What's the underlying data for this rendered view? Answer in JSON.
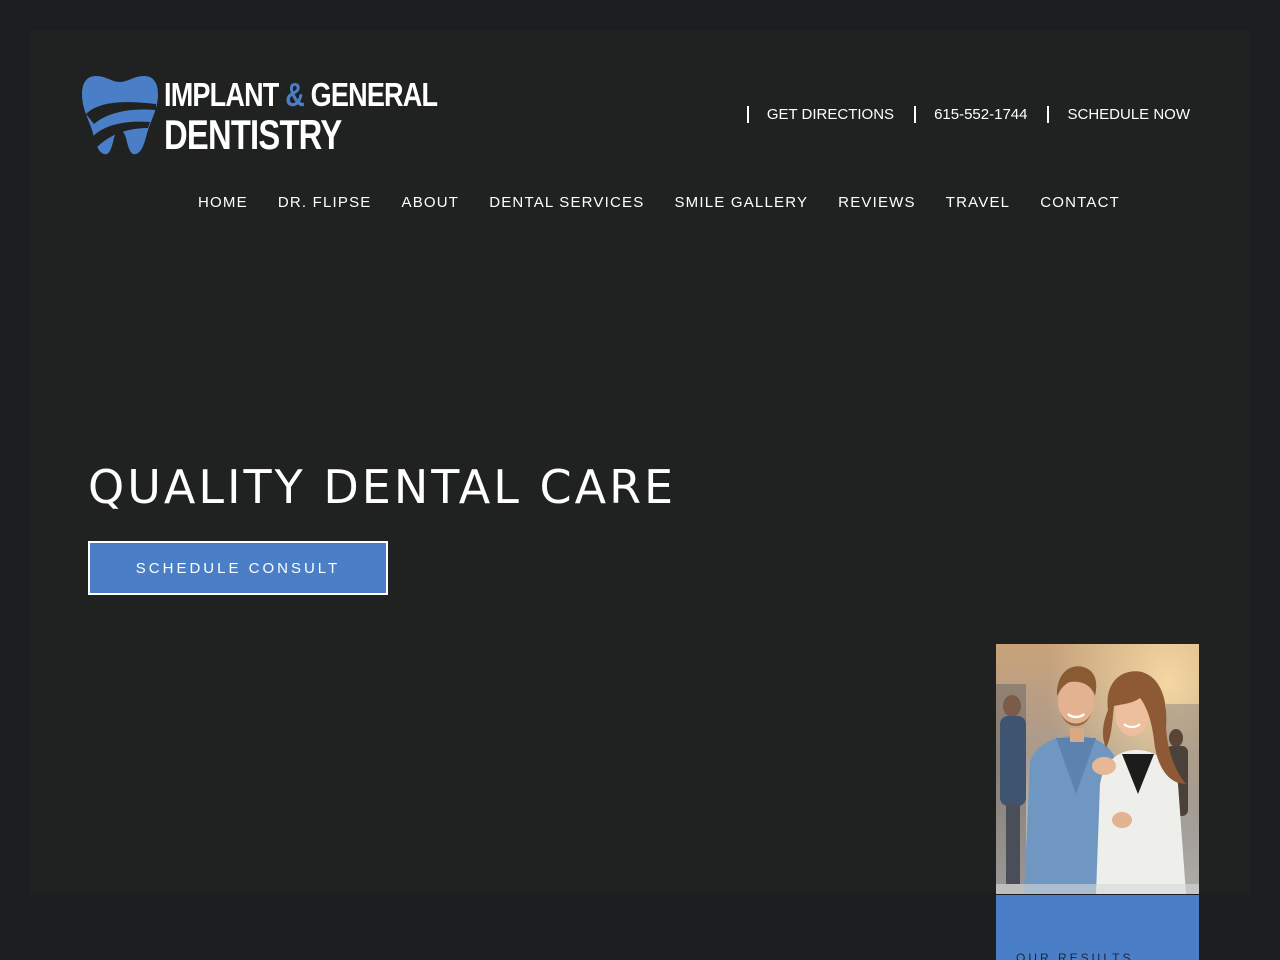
{
  "logo": {
    "line1_start": "IMPLANT",
    "line1_amp": "&",
    "line1_end": "GENERAL",
    "line2": "DENTISTRY"
  },
  "utility_nav": [
    {
      "label": "GET DIRECTIONS"
    },
    {
      "label": "615-552-1744"
    },
    {
      "label": "SCHEDULE NOW"
    }
  ],
  "main_nav": [
    {
      "label": "HOME"
    },
    {
      "label": "DR. FLIPSE"
    },
    {
      "label": "ABOUT"
    },
    {
      "label": "DENTAL SERVICES"
    },
    {
      "label": "SMILE GALLERY"
    },
    {
      "label": "REVIEWS"
    },
    {
      "label": "TRAVEL"
    },
    {
      "label": "CONTACT"
    }
  ],
  "hero": {
    "title": "QUALITY DENTAL CARE",
    "cta_label": "SCHEDULE CONSULT"
  },
  "results_card": {
    "label": "OUR RESULTS"
  },
  "colors": {
    "page_bg": "#1d1e1f",
    "panel_bg": "#202222",
    "accent_blue": "#4a7fc8",
    "text": "#ffffff"
  },
  "icons": {
    "logo_mark": "tooth-icon"
  }
}
